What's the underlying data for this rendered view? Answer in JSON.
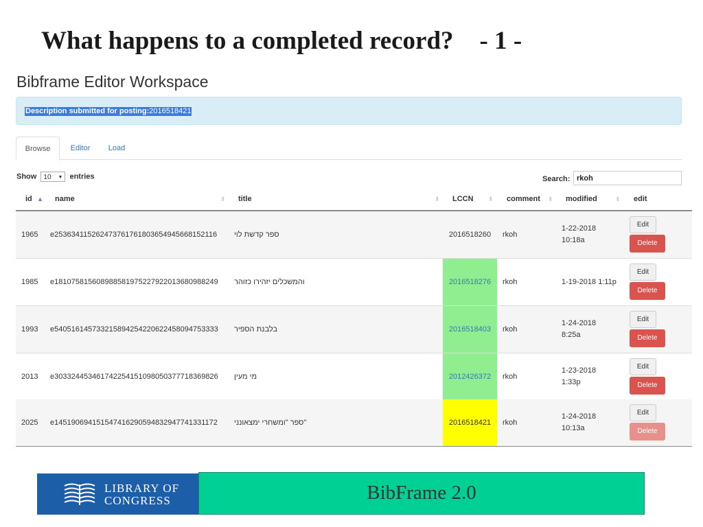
{
  "slide": {
    "title": "What happens to a completed record?",
    "page_number": "- 1 -"
  },
  "workspace": {
    "title": "Bibframe Editor Workspace",
    "alert": {
      "label": "Description submitted for posting:",
      "value": "2016518421",
      "color": "#d9edf7"
    },
    "tabs": [
      {
        "label": "Browse",
        "active": true
      },
      {
        "label": "Editor",
        "active": false
      },
      {
        "label": "Load",
        "active": false
      }
    ],
    "show_label": "Show",
    "entries_value": "10",
    "entries_label": "entries",
    "search_label": "Search:",
    "search_value": "rkoh",
    "columns": [
      "id",
      "name",
      "title",
      "LCCN",
      "comment",
      "modified",
      "edit"
    ],
    "rows": [
      {
        "id": "1965",
        "name": "e253634115262473761761803654945668152116",
        "title": "ספר קדשת לוי",
        "lccn": "2016518260",
        "lccn_highlight": "none",
        "comment": "rkoh",
        "modified_line1": "1-22-2018",
        "modified_line2": "10:18a",
        "edit_label": "Edit",
        "delete_label": "Delete",
        "delete_faded": false
      },
      {
        "id": "1985",
        "name": "e181075815608988581975227922013680988249",
        "title": "והמשכלים יזהירו כזוהר",
        "lccn": "2016518276",
        "lccn_highlight": "green",
        "comment": "rkoh",
        "modified_line1": "1-19-2018 1:11p",
        "modified_line2": "",
        "edit_label": "Edit",
        "delete_label": "Delete",
        "delete_faded": false
      },
      {
        "id": "1993",
        "name": "e540516145733215894254220622458094753333",
        "title": "בלבנת הספיר",
        "lccn": "2016518403",
        "lccn_highlight": "green",
        "comment": "rkoh",
        "modified_line1": "1-24-2018",
        "modified_line2": "8:25a",
        "edit_label": "Edit",
        "delete_label": "Delete",
        "delete_faded": false
      },
      {
        "id": "2013",
        "name": "e303324453461742254151098050377718369826",
        "title": "מי מעין",
        "lccn": "2012426372",
        "lccn_highlight": "green",
        "comment": "rkoh",
        "modified_line1": "1-23-2018",
        "modified_line2": "1:33p",
        "edit_label": "Edit",
        "delete_label": "Delete",
        "delete_faded": false
      },
      {
        "id": "2025",
        "name": "e145190694151547416290594832947741331172",
        "title": "ספר \"ומשחרי ימצאונני\"",
        "lccn": "2016518421",
        "lccn_highlight": "yellow",
        "comment": "rkoh",
        "modified_line1": "1-24-2018",
        "modified_line2": "10:13a",
        "edit_label": "Edit",
        "delete_label": "Delete",
        "delete_faded": true
      }
    ]
  },
  "footer": {
    "logo_line1": "LIBRARY OF",
    "logo_line2": "CONGRESS",
    "banner_text": "BibFrame 2.0",
    "logo_color": "#1d5ea8",
    "banner_color": "#00d094"
  },
  "colors": {
    "lccn_green": "#90ee90",
    "lccn_yellow": "#ffff00",
    "delete_red": "#d9534f",
    "link_blue": "#337ab7"
  }
}
